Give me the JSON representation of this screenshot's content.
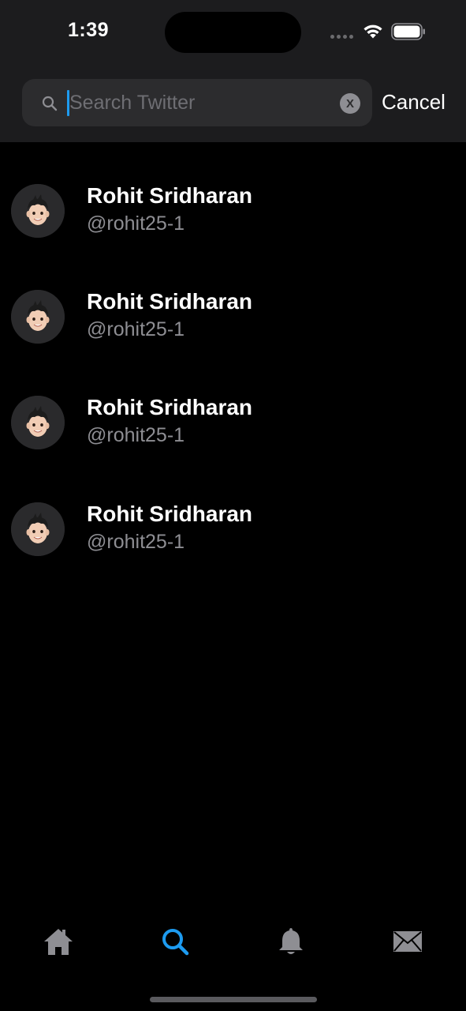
{
  "status_bar": {
    "time": "1:39"
  },
  "search": {
    "placeholder": "Search Twitter",
    "value": "",
    "cancel_label": "Cancel",
    "clear_label": "X"
  },
  "results": [
    {
      "name": "Rohit Sridharan",
      "handle": "@rohit25-1"
    },
    {
      "name": "Rohit Sridharan",
      "handle": "@rohit25-1"
    },
    {
      "name": "Rohit Sridharan",
      "handle": "@rohit25-1"
    },
    {
      "name": "Rohit Sridharan",
      "handle": "@rohit25-1"
    }
  ],
  "tab_bar": {
    "tabs": [
      {
        "icon": "home-icon",
        "active": false
      },
      {
        "icon": "search-icon",
        "active": true
      },
      {
        "icon": "bell-icon",
        "active": false
      },
      {
        "icon": "mail-icon",
        "active": false
      }
    ]
  },
  "colors": {
    "accent": "#1d9bf0",
    "background": "#000000",
    "header": "#1c1c1e",
    "inactive_icon": "#8e8e93"
  }
}
